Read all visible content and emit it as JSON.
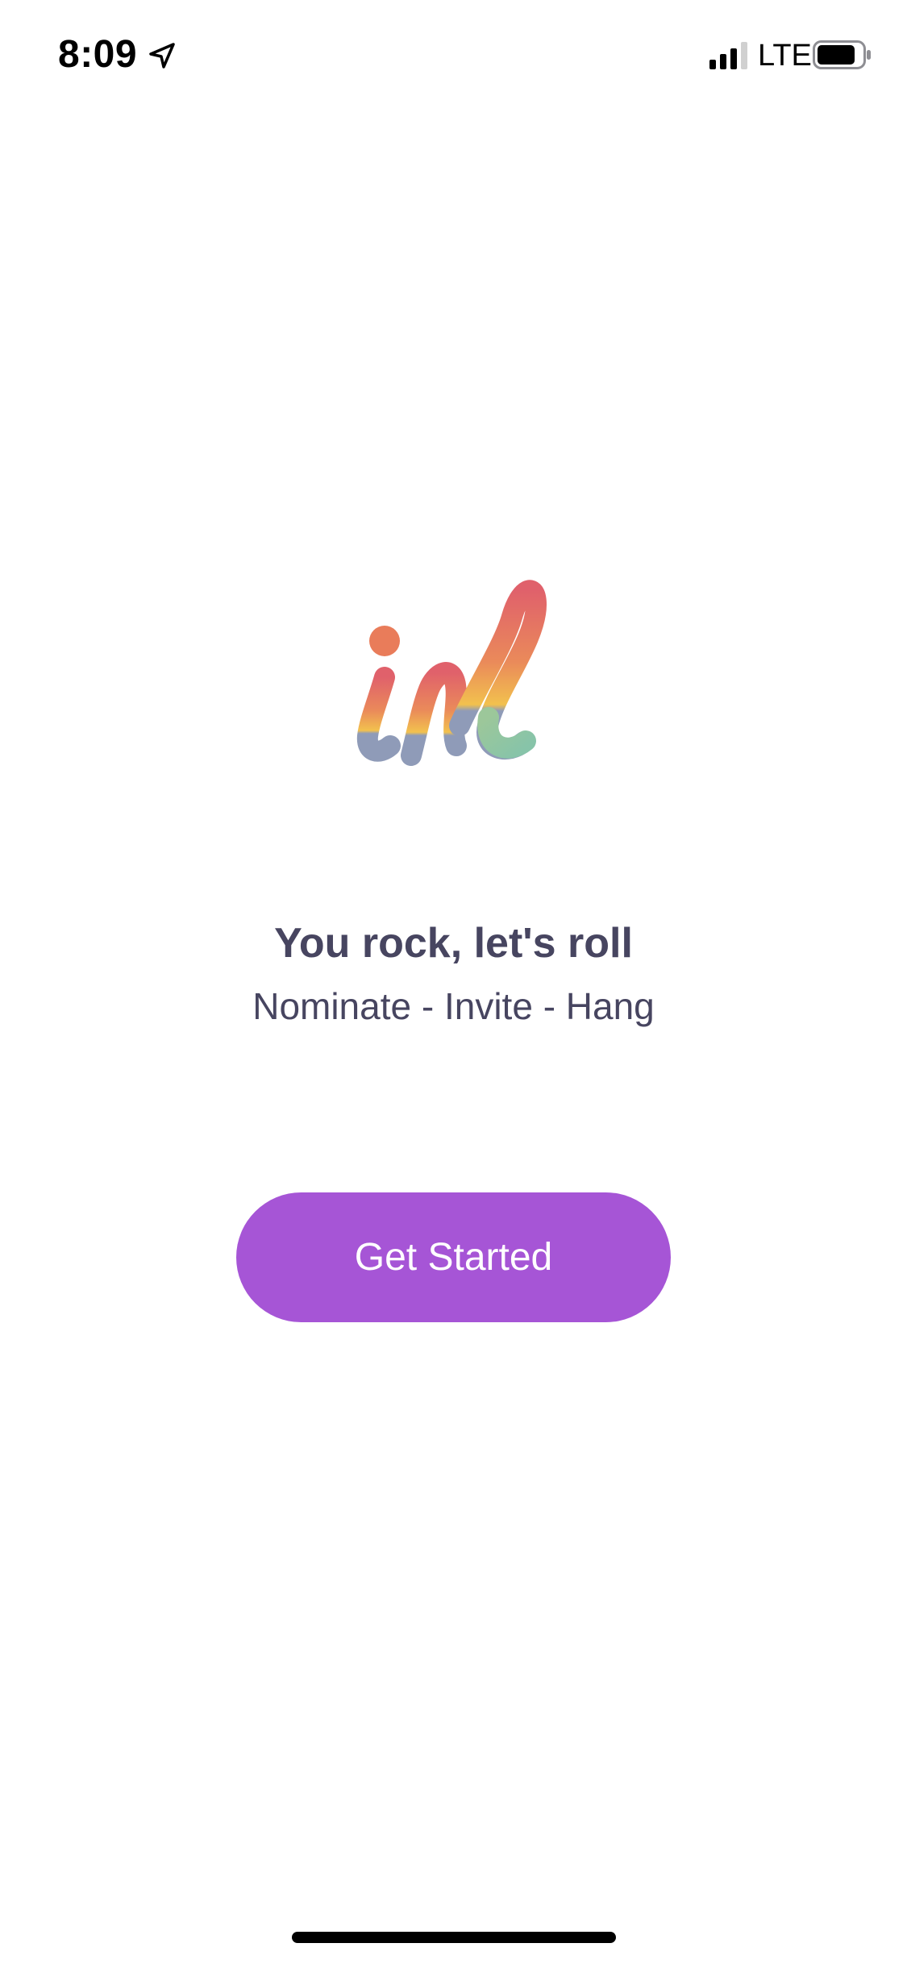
{
  "status_bar": {
    "time": "8:09",
    "network": "LTE",
    "location_icon": "location-arrow-icon",
    "signal_icon": "cellular-signal-icon",
    "battery_icon": "battery-icon"
  },
  "logo": {
    "text": "inl",
    "icon": "app-logo"
  },
  "welcome": {
    "headline": "You rock, let's roll",
    "tagline": "Nominate - Invite - Hang"
  },
  "actions": {
    "get_started_label": "Get Started"
  },
  "colors": {
    "button": "#a655d6",
    "text": "#474560",
    "logo_top": "#e0616b",
    "logo_middle": "#f2c14e",
    "logo_bottom": "#8f9bb8",
    "logo_teal": "#87c4a9"
  }
}
